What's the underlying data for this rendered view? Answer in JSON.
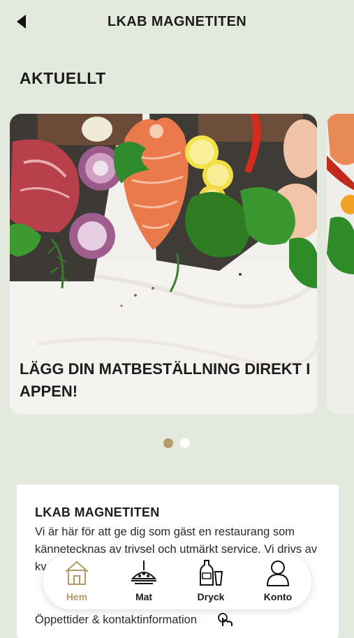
{
  "header": {
    "title": "LKAB MAGNETITEN",
    "back_icon": "back-arrow-icon"
  },
  "section": {
    "title": "AKTUELLT"
  },
  "carousel": {
    "slides": [
      {
        "title": "LÄGG DIN MATBESTÄLLNING DIREKT I APPEN!"
      }
    ],
    "dot_count": 2,
    "active_index": 0
  },
  "info": {
    "title": "LKAB MAGNETITEN",
    "text": "Vi är här för att ge dig som gäst en restaurang som kännetecknas av trivsel och utmärkt service. Vi drivs av kv... sj...",
    "link": "Öppettider & kontaktinformation"
  },
  "tabbar": {
    "tabs": [
      {
        "label": "Hem",
        "icon": "home-icon",
        "active": true
      },
      {
        "label": "Mat",
        "icon": "food-plate-icon",
        "active": false
      },
      {
        "label": "Dryck",
        "icon": "drink-icon",
        "active": false
      },
      {
        "label": "Konto",
        "icon": "account-icon",
        "active": false
      }
    ]
  },
  "colors": {
    "background": "#e3e9dd",
    "accent": "#b59b69",
    "card": "#ffffff",
    "text": "#1c1c1c"
  }
}
